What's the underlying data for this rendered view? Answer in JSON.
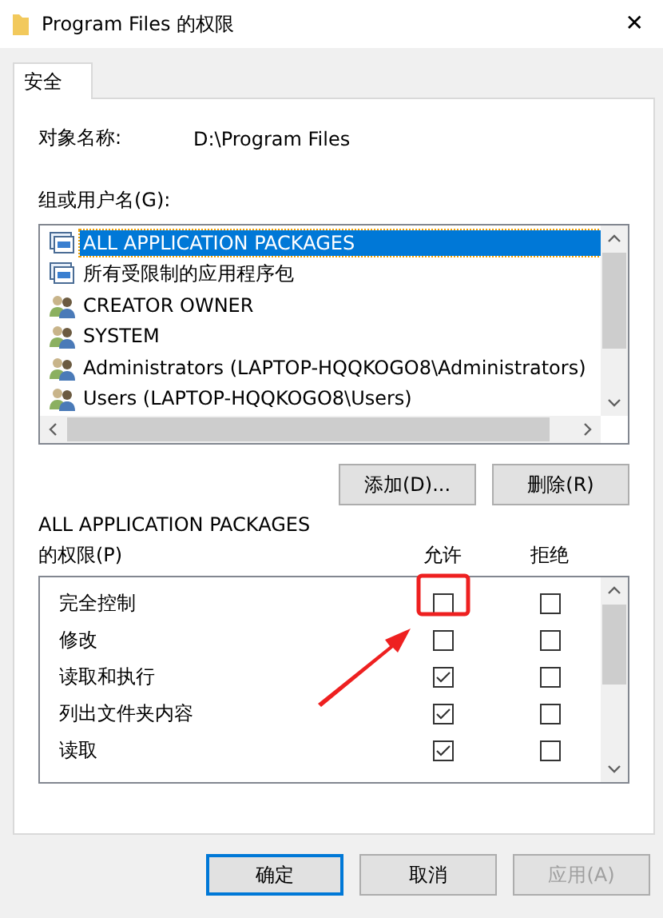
{
  "window": {
    "title": "Program Files 的权限",
    "close": "✕"
  },
  "tabs": [
    {
      "label": "安全",
      "selected": true
    }
  ],
  "object_name": {
    "label": "对象名称:",
    "value": "D:\\Program Files"
  },
  "group_label": "组或用户名(G):",
  "principals": [
    {
      "name": "ALL APPLICATION PACKAGES",
      "kind": "package",
      "selected": true
    },
    {
      "name": "所有受限制的应用程序包",
      "kind": "package",
      "selected": false
    },
    {
      "name": "CREATOR OWNER",
      "kind": "users",
      "selected": false
    },
    {
      "name": "SYSTEM",
      "kind": "users",
      "selected": false
    },
    {
      "name": "Administrators (LAPTOP-HQQKOGO8\\Administrators)",
      "kind": "users",
      "selected": false
    },
    {
      "name": "Users (LAPTOP-HQQKOGO8\\Users)",
      "kind": "users",
      "selected": false
    }
  ],
  "principal_buttons": [
    "添加(D)...",
    "删除(R)"
  ],
  "permissions_label": {
    "line_1": "ALL APPLICATION PACKAGES",
    "line_2": "的权限(P)"
  },
  "permission_columns": [
    "允许",
    "拒绝"
  ],
  "permissions": [
    {
      "name": "完全控制",
      "allow": false,
      "deny": false
    },
    {
      "name": "修改",
      "allow": false,
      "deny": false
    },
    {
      "name": "读取和执行",
      "allow": true,
      "deny": false
    },
    {
      "name": "列出文件夹内容",
      "allow": true,
      "deny": false
    },
    {
      "name": "读取",
      "allow": true,
      "deny": false
    }
  ],
  "buttons": [
    {
      "label": "确定",
      "kind": "default",
      "disabled": false
    },
    {
      "label": "取消",
      "kind": "normal",
      "disabled": false
    },
    {
      "label": "应用(A)",
      "kind": "normal",
      "disabled": true
    }
  ]
}
